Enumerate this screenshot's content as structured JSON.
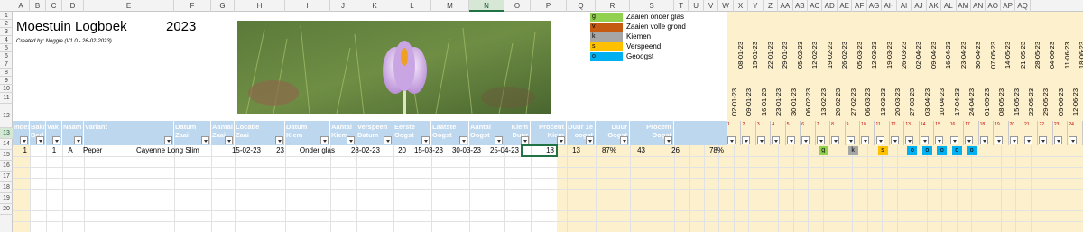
{
  "columns": [
    "A",
    "B",
    "C",
    "D",
    "E",
    "F",
    "G",
    "H",
    "I",
    "J",
    "K",
    "L",
    "M",
    "N",
    "O",
    "P",
    "Q",
    "R",
    "S",
    "T",
    "U",
    "V",
    "W",
    "X",
    "Y",
    "Z",
    "AA",
    "AB",
    "AC",
    "AD",
    "AE",
    "AF",
    "AG",
    "AH",
    "AI",
    "AJ",
    "AK",
    "AL",
    "AM",
    "AN",
    "AO",
    "AP",
    "AQ"
  ],
  "selected_column": "N",
  "rows": [
    "1",
    "2",
    "3",
    "4",
    "5",
    "6",
    "7",
    "8",
    "9",
    "10",
    "11",
    "12",
    "13",
    "14",
    "15",
    "16",
    "17",
    "18",
    "19",
    "20"
  ],
  "selected_row": "13",
  "sheet": {
    "title": "Moestuin Logboek",
    "year": "2023",
    "created_by": "Created by: Noggie (V1.0 - 26-02-2023)"
  },
  "legend": [
    {
      "code": "g",
      "label": "Zaaien onder glas",
      "color": "#92d050"
    },
    {
      "code": "v",
      "label": "Zaaien volle grond",
      "color": "#c55a11"
    },
    {
      "code": "k",
      "label": "Kiemen",
      "color": "#a6a6a6"
    },
    {
      "code": "s",
      "label": "Verspeend",
      "color": "#ffc000"
    },
    {
      "code": "o",
      "label": "Geoogst",
      "color": "#00b0f0"
    }
  ],
  "dates_top": [
    "08-01-23",
    "15-01-23",
    "22-01-23",
    "29-01-23",
    "05-02-23",
    "12-02-23",
    "19-02-23",
    "26-02-23",
    "05-03-23",
    "12-03-23",
    "19-03-23",
    "26-03-23",
    "02-04-23",
    "09-04-23",
    "16-04-23",
    "23-04-23",
    "30-04-23",
    "07-05-23",
    "14-05-23",
    "21-05-23",
    "28-05-23",
    "04-06-23",
    "11-06-23",
    "18-06-23"
  ],
  "dates_bottom": [
    "02-01-23",
    "09-01-23",
    "16-01-23",
    "23-01-23",
    "30-01-23",
    "06-02-23",
    "13-02-23",
    "20-02-23",
    "27-02-23",
    "06-03-23",
    "13-03-23",
    "20-03-23",
    "27-03-23",
    "03-04-23",
    "10-04-23",
    "17-04-23",
    "24-04-23",
    "01-05-23",
    "08-05-23",
    "15-05-23",
    "22-05-23",
    "29-05-23",
    "05-06-23",
    "12-06-23"
  ],
  "headers": [
    {
      "label": "Index"
    },
    {
      "label": "Bak/\nBed"
    },
    {
      "label": "Vak"
    },
    {
      "label": "Naam"
    },
    {
      "label": "Variant"
    },
    {
      "label": "Datum\nZaai"
    },
    {
      "label": "Aantal\nZaai"
    },
    {
      "label": "Locatie\nZaai"
    },
    {
      "label": "Datum\nKiem"
    },
    {
      "label": "Aantal\nKiem"
    },
    {
      "label": "Verspeen\nDatum"
    },
    {
      "label": "Eerste\nOogst"
    },
    {
      "label": "Laatste\nOogst"
    },
    {
      "label": "Aantal\nOogst"
    },
    {
      "label": "Kiem\nDuur"
    },
    {
      "label": "Procent\nKiem"
    },
    {
      "label": "Duur 1e\noogst"
    },
    {
      "label": "Duur\nOogst"
    },
    {
      "label": "Procent\nOogst"
    }
  ],
  "week_numbers": [
    "1",
    "2",
    "3",
    "4",
    "5",
    "6",
    "7",
    "8",
    "9",
    "10",
    "11",
    "12",
    "13",
    "14",
    "15",
    "16",
    "17",
    "18",
    "19",
    "20",
    "21",
    "22",
    "23",
    "24"
  ],
  "data_row": {
    "index": "1",
    "bak": "1",
    "vak": "A",
    "naam": "Peper",
    "variant": "Cayenne Long Slim",
    "datum_zaai": "15-02-23",
    "aantal_zaai": "23",
    "locatie_zaai": "Onder glas",
    "datum_kiem": "28-02-23",
    "aantal_kiem": "20",
    "verspeen_datum": "15-03-23",
    "eerste_oogst": "30-03-23",
    "laatste_oogst": "25-04-23",
    "aantal_oogst": "18",
    "kiem_duur": "13",
    "procent_kiem": "87%",
    "duur_1e_oogst": "43",
    "duur_oogst": "26",
    "procent_oogst": "78%"
  },
  "week_marks": [
    {
      "week": 7,
      "code": "g",
      "color": "#92d050"
    },
    {
      "week": 9,
      "code": "k",
      "color": "#a6a6a6"
    },
    {
      "week": 11,
      "code": "s",
      "color": "#ffc000"
    },
    {
      "week": 13,
      "code": "o",
      "color": "#00b0f0"
    },
    {
      "week": 14,
      "code": "o",
      "color": "#00b0f0"
    },
    {
      "week": 15,
      "code": "o",
      "color": "#00b0f0"
    },
    {
      "week": 16,
      "code": "o",
      "color": "#00b0f0"
    },
    {
      "week": 17,
      "code": "o",
      "color": "#00b0f0"
    }
  ]
}
